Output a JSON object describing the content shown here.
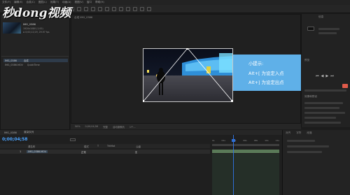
{
  "watermark": {
    "text": "秒dong视频"
  },
  "menubar": {
    "items": [
      "文件(F)",
      "编辑(E)",
      "合成(C)",
      "图层(L)",
      "效果(T)",
      "动画(A)",
      "视图(V)",
      "窗口",
      "帮助(H)"
    ]
  },
  "project_panel": {
    "title": "项目",
    "footage": {
      "name": "IMG_0386",
      "info_line1": "1920x1080 (1.00)",
      "info_line2": "Δ 0;00;12;29, 29.97 fps"
    },
    "items": [
      {
        "name": "IMG_0386",
        "type": "合成"
      },
      {
        "name": "IMG_0386.MOV",
        "type": "QuickTime"
      }
    ]
  },
  "viewer": {
    "tab": "合成 IMG_0386",
    "overlay_tip": {
      "title": "小提示:",
      "line1": "Alt+[  为设定入点",
      "line2": "Alt+]  为设定出点"
    },
    "bottom_bar": {
      "zoom": "50%",
      "timecode": "0;00;04;58",
      "res": "完整",
      "camera": "活动摄像机",
      "views": "1个..."
    }
  },
  "right_panel": {
    "title": "信息",
    "sections": [
      "预览",
      "效果和预设",
      "对齐",
      "字符",
      "段落"
    ]
  },
  "timeline": {
    "tab": "IMG_0386",
    "render_queue": "渲染队列",
    "timecode": "0;00;04;58",
    "columns": [
      "源名称",
      "模式",
      "T",
      "TrkMat",
      "父级"
    ],
    "layers": [
      {
        "index": "1",
        "name": "IMG_0386.MOV",
        "mode": "正常",
        "parent": "无"
      }
    ],
    "ruler": [
      "0s",
      "02s",
      "04s",
      "06s",
      "08s",
      "10s",
      "12s"
    ]
  },
  "side_panel": {
    "tabs": [
      "对齐",
      "字符",
      "段落"
    ]
  },
  "colors": {
    "tip_bg": "#5fb0e8",
    "cti": "#2f6fd6",
    "timecode": "#4aa3ff"
  }
}
